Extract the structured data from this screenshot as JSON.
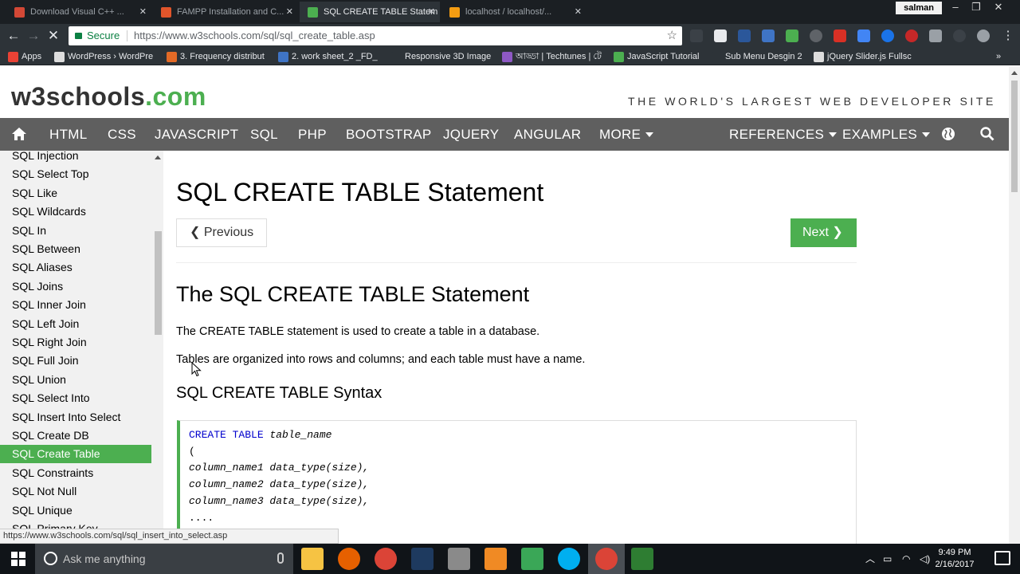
{
  "browser": {
    "tabs": [
      {
        "label": "Download Visual C++ ...",
        "active": false,
        "color": "#d34836"
      },
      {
        "label": "FAMPP Installation and C...",
        "active": false,
        "color": "#e0552b"
      },
      {
        "label": "SQL CREATE TABLE Statem",
        "active": true,
        "color": "#4caf50"
      },
      {
        "label": "localhost / localhost/...",
        "active": false,
        "color": "#f39c12"
      }
    ],
    "user": "salman",
    "secure_label": "Secure",
    "url": "https://www.w3schools.com/sql/sql_create_table.asp",
    "bookmarks": [
      {
        "label": "Apps",
        "color": "#e94235"
      },
      {
        "label": "WordPress › WordPre",
        "color": "#dddddd"
      },
      {
        "label": "3. Frequency distribut",
        "color": "#e46a26"
      },
      {
        "label": "2. work sheet_2 _FD_",
        "color": "#3f74c5"
      },
      {
        "label": "Responsive 3D Image",
        "color": "#2d3338"
      },
      {
        "label": "আড্ডা | Techtunes | টে",
        "color": "#8e59c4"
      },
      {
        "label": "JavaScript Tutorial",
        "color": "#4caf50"
      },
      {
        "label": "Sub Menu Desgin 2",
        "color": "#2d3338"
      },
      {
        "label": "jQuery Slider.js Fullsc",
        "color": "#dddddd"
      }
    ],
    "status_url": "https://www.w3schools.com/sql/sql_insert_into_select.asp"
  },
  "site": {
    "logo_main": "w3schools",
    "logo_dot": ".com",
    "tagline": "THE WORLD'S LARGEST WEB DEVELOPER SITE",
    "nav": [
      "HTML",
      "CSS",
      "JAVASCRIPT",
      "SQL",
      "PHP",
      "BOOTSTRAP",
      "JQUERY",
      "ANGULAR",
      "MORE"
    ],
    "nav_right": [
      "REFERENCES",
      "EXAMPLES"
    ]
  },
  "sidebar": {
    "items": [
      "SQL Injection",
      "SQL Select Top",
      "SQL Like",
      "SQL Wildcards",
      "SQL In",
      "SQL Between",
      "SQL Aliases",
      "SQL Joins",
      "SQL Inner Join",
      "SQL Left Join",
      "SQL Right Join",
      "SQL Full Join",
      "SQL Union",
      "SQL Select Into",
      "SQL Insert Into Select",
      "SQL Create DB",
      "SQL Create Table",
      "SQL Constraints",
      "SQL Not Null",
      "SQL Unique",
      "SQL Primary Key"
    ],
    "active_index": 16
  },
  "main": {
    "title": "SQL CREATE TABLE Statement",
    "prev_label": "Previous",
    "next_label": "Next",
    "section_title": "The SQL CREATE TABLE Statement",
    "para1": "The CREATE TABLE statement is used to create a table in a database.",
    "para2": "Tables are organized into rows and columns; and each table must have a name.",
    "syntax_title": "SQL CREATE TABLE Syntax",
    "code": {
      "kw": "CREATE TABLE",
      "table": "table_name",
      "open": "(",
      "lines": [
        "column_name1 data_type(size),",
        "column_name2 data_type(size),",
        "column_name3 data_type(size),",
        "...."
      ]
    }
  },
  "taskbar": {
    "search_placeholder": "Ask me anything",
    "time": "9:49 PM",
    "date": "2/16/2017"
  }
}
